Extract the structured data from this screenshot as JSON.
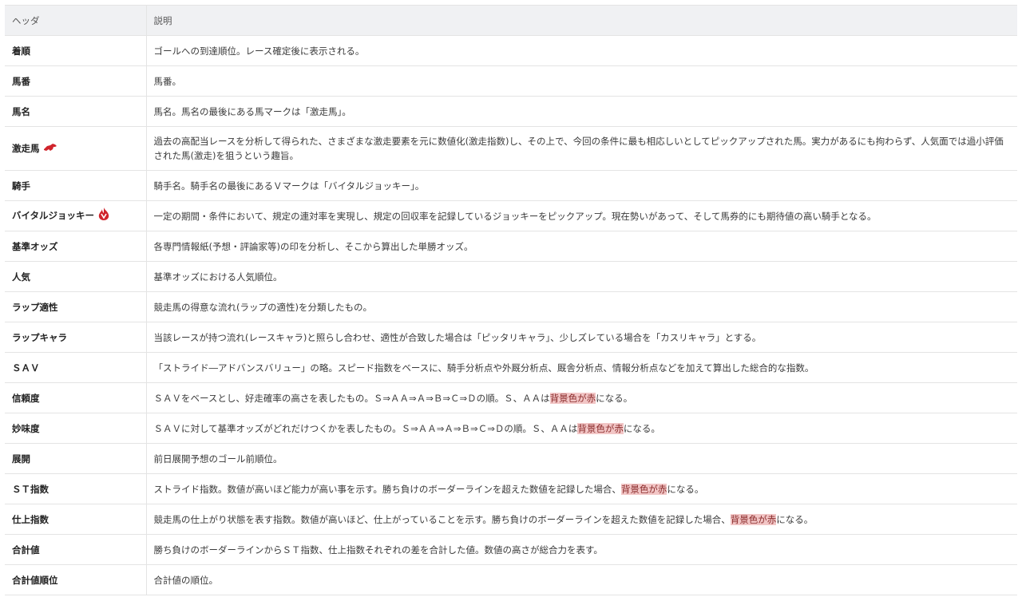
{
  "table": {
    "headers": [
      "ヘッダ",
      "説明"
    ],
    "rows": [
      {
        "name": "着順",
        "desc": [
          "ゴールへの到達順位。レース確定後に表示される。"
        ]
      },
      {
        "name": "馬番",
        "desc": [
          "馬番。"
        ]
      },
      {
        "name": "馬名",
        "desc": [
          "馬名。馬名の最後にある馬マークは「激走馬」。"
        ]
      },
      {
        "name": "激走馬",
        "icon": "red-horse-icon",
        "desc": [
          "過去の高配当レースを分析して得られた、さまざまな激走要素を元に数値化(激走指数)し、その上で、今回の条件に最も相応しいとしてピックアップされた馬。実力があるにも拘わらず、人気面では過小評価された馬(激走)を狙うという趣旨。"
        ]
      },
      {
        "name": "騎手",
        "desc": [
          "騎手名。騎手名の最後にあるＶマークは「バイタルジョッキー」。"
        ]
      },
      {
        "name": "バイタルジョッキー",
        "icon": "vital-v-flame-icon",
        "desc": [
          "一定の期間・条件において、規定の連対率を実現し、規定の回収率を記録しているジョッキーをピックアップ。現在勢いがあって、そして馬券的にも期待値の高い騎手となる。"
        ]
      },
      {
        "name": "基準オッズ",
        "desc": [
          "各専門情報紙(予想・評論家等)の印を分析し、そこから算出した単勝オッズ。"
        ]
      },
      {
        "name": "人気",
        "desc": [
          "基準オッズにおける人気順位。"
        ]
      },
      {
        "name": "ラップ適性",
        "desc": [
          "競走馬の得意な流れ(ラップの適性)を分類したもの。"
        ]
      },
      {
        "name": "ラップキャラ",
        "desc": [
          "当該レースが持つ流れ(レースキャラ)と照らし合わせ、適性が合致した場合は「ピッタリキャラ」、少しズレている場合を「カスリキャラ」とする。"
        ]
      },
      {
        "name": "ＳＡＶ",
        "desc": [
          "「ストライド―アドバンスバリュー」の略。スピード指数をベースに、騎手分析点や外厩分析点、厩舎分析点、情報分析点などを加えて算出した総合的な指数。"
        ]
      },
      {
        "name": "信頼度",
        "desc": [
          "ＳＡＶをベースとし、好走確率の高さを表したもの。Ｓ⇒ＡＡ⇒Ａ⇒Ｂ⇒Ｃ⇒Ｄの順。Ｓ、ＡＡは",
          "背景色が赤",
          "になる。"
        ]
      },
      {
        "name": "妙味度",
        "desc": [
          "ＳＡＶに対して基準オッズがどれだけつくかを表したもの。Ｓ⇒ＡＡ⇒Ａ⇒Ｂ⇒Ｃ⇒Ｄの順。Ｓ、ＡＡは",
          "背景色が赤",
          "になる。"
        ]
      },
      {
        "name": "展開",
        "desc": [
          "前日展開予想のゴール前順位。"
        ]
      },
      {
        "name": "ＳＴ指数",
        "desc": [
          "ストライド指数。数値が高いほど能力が高い事を示す。勝ち負けのボーダーラインを超えた数値を記録した場合、",
          "背景色が赤",
          "になる。"
        ]
      },
      {
        "name": "仕上指数",
        "desc": [
          "競走馬の仕上がり状態を表す指数。数値が高いほど、仕上がっていることを示す。勝ち負けのボーダーラインを超えた数値を記録した場合、",
          "背景色が赤",
          "になる。"
        ]
      },
      {
        "name": "合計値",
        "desc": [
          "勝ち負けのボーダーラインからＳＴ指数、仕上指数それぞれの差を合計した値。数値の高さが総合力を表す。"
        ]
      },
      {
        "name": "合計値順位",
        "desc": [
          "合計値の順位。"
        ]
      }
    ],
    "colors": {
      "header_bg": "#f0f1f3",
      "border": "#e4e4e4",
      "highlight_bg": "#f2c6c6",
      "highlight_text": "#8a2b2b",
      "icon_red": "#d0242c"
    }
  }
}
